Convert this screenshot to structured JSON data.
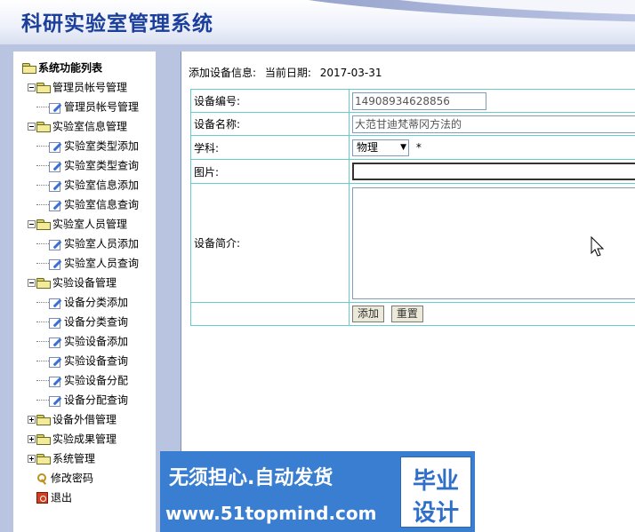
{
  "app": {
    "title": "科研实验室管理系统"
  },
  "sidebar": {
    "root": "系统功能列表",
    "groups": [
      {
        "label": "管理员帐号管理",
        "items": [
          "管理员帐号管理"
        ]
      },
      {
        "label": "实验室信息管理",
        "items": [
          "实验室类型添加",
          "实验室类型查询",
          "实验室信息添加",
          "实验室信息查询"
        ]
      },
      {
        "label": "实验室人员管理",
        "items": [
          "实验室人员添加",
          "实验室人员查询"
        ]
      },
      {
        "label": "实验设备管理",
        "items": [
          "设备分类添加",
          "设备分类查询",
          "实验设备添加",
          "实验设备查询",
          "实验设备分配",
          "设备分配查询"
        ]
      },
      {
        "label": "设备外借管理"
      },
      {
        "label": "实验成果管理"
      },
      {
        "label": "系统管理"
      }
    ],
    "links": [
      "修改密码",
      "退出"
    ]
  },
  "main": {
    "header_label": "添加设备信息:",
    "date_label": "当前日期:",
    "date_value": "2017-03-31",
    "form": {
      "device_id": {
        "label": "设备编号:",
        "value": "14908934628856"
      },
      "device_name": {
        "label": "设备名称:",
        "value": "大范甘迪梵蒂冈方法的"
      },
      "subject": {
        "label": "学科:",
        "value": "物理",
        "required_mark": "*"
      },
      "image": {
        "label": "图片:",
        "value": ""
      },
      "intro": {
        "label": "设备简介:",
        "value": ""
      },
      "add_button": "添加",
      "reset_button": "重置"
    }
  },
  "watermark": {
    "line1": "无须担心.自动发货",
    "line2": "www.51topmind.com",
    "badge1": "毕业",
    "badge2": "设计"
  }
}
